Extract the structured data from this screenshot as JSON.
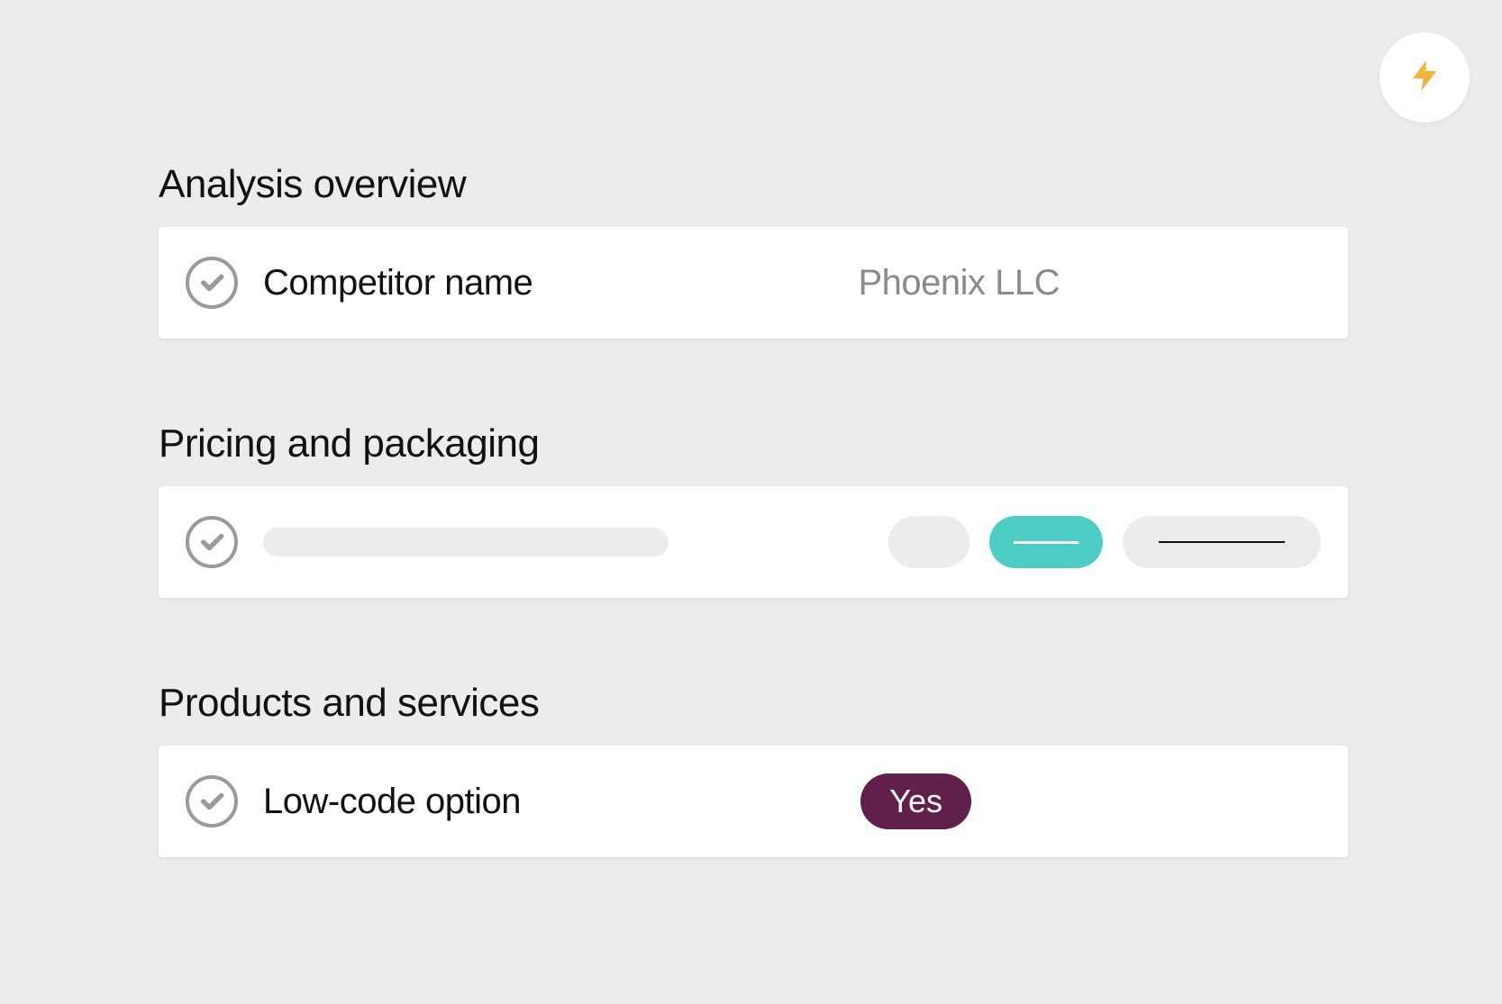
{
  "lightning_icon_name": "lightning-icon",
  "sections": {
    "analysis": {
      "heading": "Analysis overview",
      "field_label": "Competitor name",
      "field_value": "Phoenix LLC"
    },
    "pricing": {
      "heading": "Pricing and packaging"
    },
    "products": {
      "heading": "Products and services",
      "field_label": "Low-code option",
      "badge_value": "Yes"
    }
  },
  "colors": {
    "teal": "#4ecdc4",
    "badge_bg": "#611f4b",
    "lightning": "#f2b441"
  }
}
